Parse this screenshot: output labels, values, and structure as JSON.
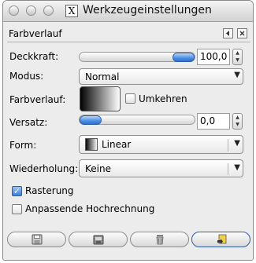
{
  "window": {
    "title": "Werkzeugeinstellungen"
  },
  "dock": {
    "title": "Farbverlauf"
  },
  "opacity": {
    "label": "Deckkraft:",
    "value": "100,0",
    "level": 1.0
  },
  "mode": {
    "label": "Modus:",
    "value": "Normal"
  },
  "gradient": {
    "label": "Farbverlauf:",
    "reverse_label": "Umkehren",
    "reverse_checked": false
  },
  "offset": {
    "label": "Versatz:",
    "value": "0,0",
    "level": 0.0
  },
  "shape": {
    "label": "Form:",
    "value": "Linear"
  },
  "repeat": {
    "label": "Wiederholung:",
    "value": "Keine"
  },
  "dithering": {
    "label": "Rasterung",
    "checked": true
  },
  "adaptive": {
    "label": "Anpassende Hochrechnung",
    "checked": false
  },
  "buttons": [
    {
      "icon": "save-icon"
    },
    {
      "icon": "restore-icon"
    },
    {
      "icon": "delete-icon"
    },
    {
      "icon": "reset-icon"
    }
  ],
  "colors": {
    "accent": "#3a7fd9",
    "window_bg": "#ececec"
  }
}
